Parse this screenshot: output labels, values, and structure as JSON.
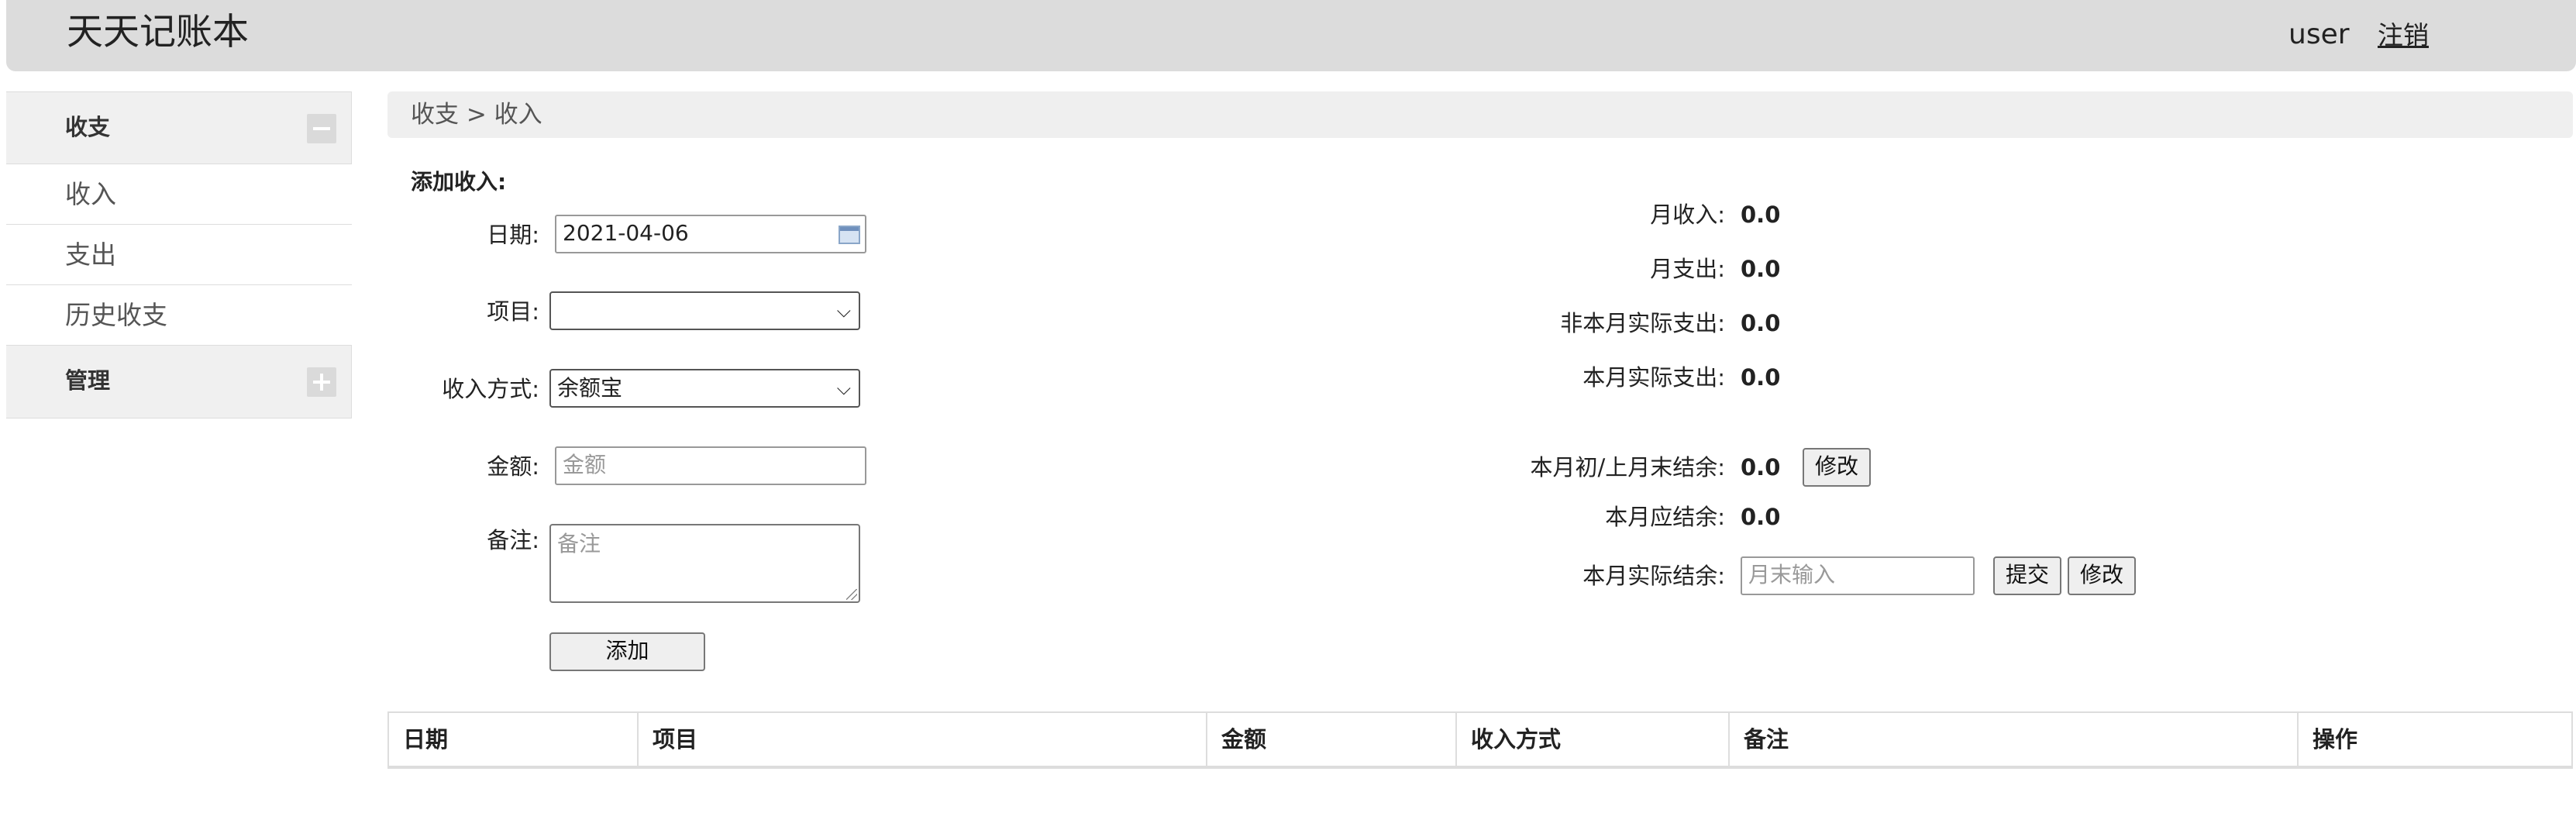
{
  "header": {
    "app_title": "天天记账本",
    "user_name": "user",
    "logout_label": "注销"
  },
  "sidebar": {
    "groups": [
      {
        "label": "收支",
        "toggle_icon": "minus-icon",
        "expanded": true,
        "items": [
          {
            "label": "收入"
          },
          {
            "label": "支出"
          },
          {
            "label": "历史收支"
          }
        ]
      },
      {
        "label": "管理",
        "toggle_icon": "plus-icon",
        "expanded": false,
        "items": []
      }
    ]
  },
  "breadcrumb": "收支 > 收入",
  "form": {
    "heading": "添加收入:",
    "date_label": "日期:",
    "date_value": "2021-04-06",
    "item_label": "项目:",
    "item_value": "",
    "method_label": "收入方式:",
    "method_value": "余额宝",
    "amount_label": "金额:",
    "amount_placeholder": "金额",
    "note_label": "备注:",
    "note_placeholder": "备注",
    "add_button": "添加"
  },
  "stats": {
    "monthly_income_label": "月收入:",
    "monthly_income_value": "0.0",
    "monthly_expense_label": "月支出:",
    "monthly_expense_value": "0.0",
    "non_month_actual_expense_label": "非本月实际支出:",
    "non_month_actual_expense_value": "0.0",
    "month_actual_expense_label": "本月实际支出:",
    "month_actual_expense_value": "0.0",
    "opening_balance_label": "本月初/上月末结余:",
    "opening_balance_value": "0.0",
    "opening_balance_edit": "修改",
    "expected_balance_label": "本月应结余:",
    "expected_balance_value": "0.0",
    "actual_balance_label": "本月实际结余:",
    "actual_balance_placeholder": "月末输入",
    "submit_button": "提交",
    "edit_button": "修改"
  },
  "table": {
    "headers": [
      "日期",
      "项目",
      "金额",
      "收入方式",
      "备注",
      "操作"
    ],
    "rows": []
  }
}
